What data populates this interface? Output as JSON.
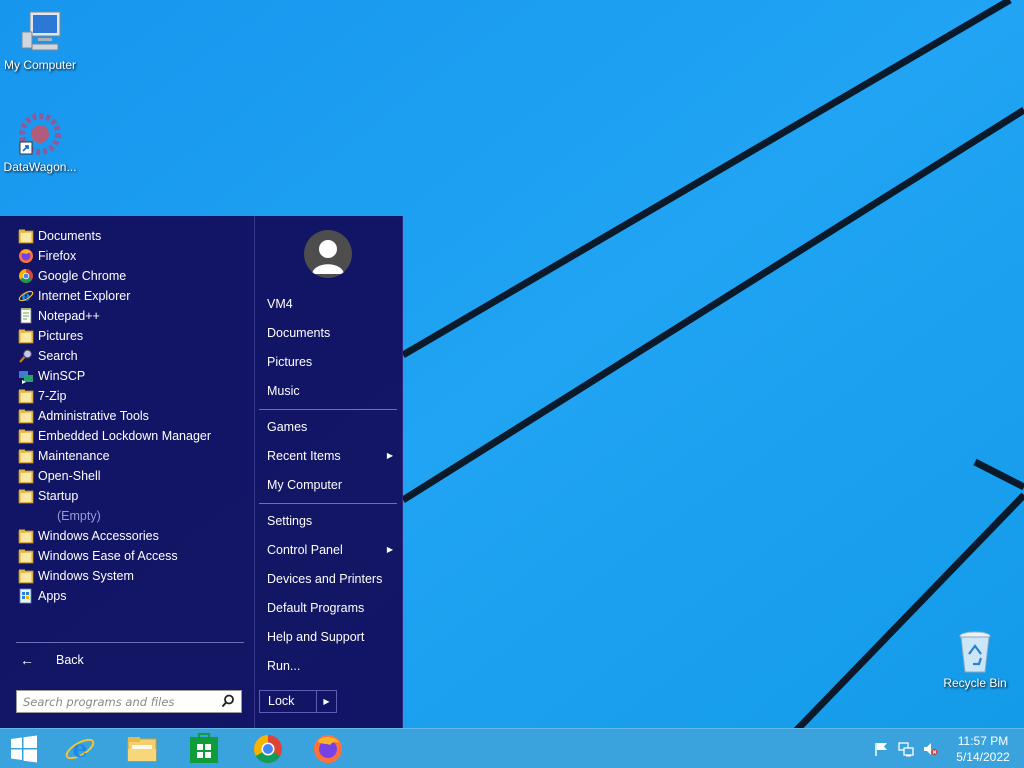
{
  "desktop": {
    "icons": [
      {
        "name": "my-computer",
        "label": "My Computer"
      },
      {
        "name": "datawagon",
        "label": "DataWagon..."
      },
      {
        "name": "recycle-bin",
        "label": "Recycle Bin"
      }
    ]
  },
  "start_menu": {
    "programs": [
      {
        "label": "Documents",
        "icon": "folder-icon"
      },
      {
        "label": "Firefox",
        "icon": "firefox-icon"
      },
      {
        "label": "Google Chrome",
        "icon": "chrome-icon"
      },
      {
        "label": "Internet Explorer",
        "icon": "ie-icon"
      },
      {
        "label": "Notepad++",
        "icon": "notepad-plus-icon"
      },
      {
        "label": "Pictures",
        "icon": "folder-icon"
      },
      {
        "label": "Search",
        "icon": "search-icon"
      },
      {
        "label": "WinSCP",
        "icon": "winscp-icon"
      },
      {
        "label": "7-Zip",
        "icon": "folder-icon"
      },
      {
        "label": "Administrative Tools",
        "icon": "folder-icon"
      },
      {
        "label": "Embedded Lockdown Manager",
        "icon": "folder-icon"
      },
      {
        "label": "Maintenance",
        "icon": "folder-icon"
      },
      {
        "label": "Open-Shell",
        "icon": "folder-icon"
      },
      {
        "label": "Startup",
        "icon": "folder-icon"
      },
      {
        "label": "(Empty)",
        "icon": ""
      },
      {
        "label": "Windows Accessories",
        "icon": "folder-icon"
      },
      {
        "label": "Windows Ease of Access",
        "icon": "folder-icon"
      },
      {
        "label": "Windows System",
        "icon": "folder-icon"
      },
      {
        "label": "Apps",
        "icon": "apps-icon"
      }
    ],
    "back_label": "Back",
    "search_placeholder": "Search programs and files",
    "right": {
      "user": "VM4",
      "documents": "Documents",
      "pictures": "Pictures",
      "music": "Music",
      "games": "Games",
      "recent_items": "Recent Items",
      "my_computer": "My Computer",
      "settings": "Settings",
      "control_panel": "Control Panel",
      "devices_printers": "Devices and Printers",
      "default_programs": "Default Programs",
      "help_support": "Help and Support",
      "run": "Run..."
    },
    "lock_label": "Lock"
  },
  "taskbar": {
    "pinned": [
      "internet-explorer",
      "file-explorer",
      "store",
      "chrome",
      "firefox"
    ],
    "clock": {
      "time": "11:57 PM",
      "date": "5/14/2022"
    }
  },
  "colors": {
    "wallpaper": "#1E9DF0",
    "start_menu_bg": "#12105F",
    "taskbar": "#3AA3DD"
  }
}
